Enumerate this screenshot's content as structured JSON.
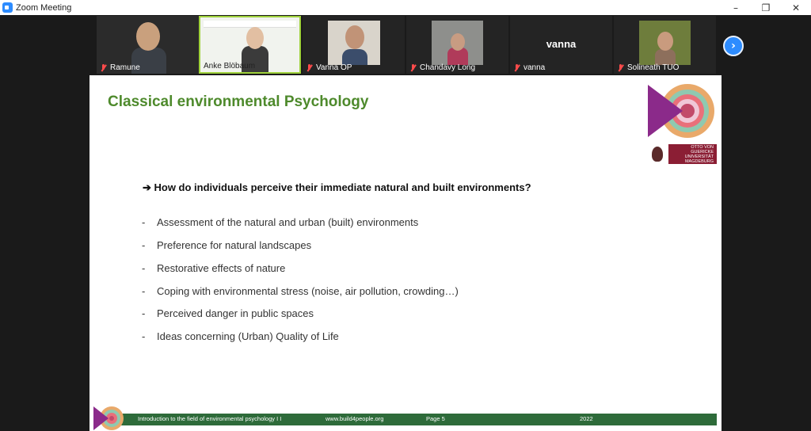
{
  "window": {
    "title": "Zoom Meeting",
    "controls": [
      "–",
      "❐",
      "✕"
    ]
  },
  "participants": [
    {
      "name": "Ramune",
      "muted": true
    },
    {
      "name": "Anke Blöbaum",
      "muted": false,
      "active": true
    },
    {
      "name": "Vanna OP",
      "muted": true
    },
    {
      "name": "Chandavy Long",
      "muted": true
    },
    {
      "name": "vanna",
      "muted": true,
      "display_name": "vanna"
    },
    {
      "name": "Solineath TUO",
      "muted": true
    }
  ],
  "gallery": {
    "next_icon": "›"
  },
  "slide": {
    "title": "Classical environmental Psychology",
    "question": "➔ How do individuals perceive their immediate natural and built environments?",
    "bullets": [
      "Assessment of the natural and urban (built)  environments",
      "Preference for natural landscapes",
      "Restorative effects of nature",
      "Coping with environmental  stress (noise, air pollution, crowding…)",
      "Perceived danger in public spaces",
      "Ideas concerning (Urban) Quality of Life"
    ],
    "bullet_marker": "-",
    "university": {
      "line1": "OTTO VON GUERICKE",
      "line2": "UNIVERSITÄT",
      "line3": "MAGDEBURG"
    },
    "footer": {
      "course": "Introduction to the field of environmental psychology  I I",
      "url": "www.build4people.org",
      "page": "Page 5",
      "year": "2022"
    },
    "colors": {
      "title_green": "#4e8a2c",
      "footer_green": "#2e6b3a",
      "uni_red": "#8b1e34",
      "logo_purple": "#8b2a8a"
    }
  }
}
